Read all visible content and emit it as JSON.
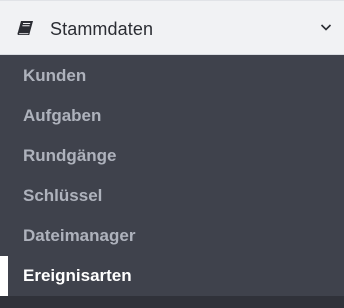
{
  "header": {
    "title": "Stammdaten",
    "icon": "book-icon",
    "toggle_icon": "chevron-down-icon"
  },
  "menu": {
    "items": [
      {
        "label": "Kunden",
        "active": false
      },
      {
        "label": "Aufgaben",
        "active": false
      },
      {
        "label": "Rundgänge",
        "active": false
      },
      {
        "label": "Schlüssel",
        "active": false
      },
      {
        "label": "Dateimanager",
        "active": false
      },
      {
        "label": "Ereignisarten",
        "active": true
      }
    ]
  },
  "colors": {
    "header_bg": "#f1f2f4",
    "menu_bg": "#3f424c",
    "inactive_text": "#aeb2bc",
    "active_text": "#ffffff",
    "active_indicator": "#ffffff"
  }
}
